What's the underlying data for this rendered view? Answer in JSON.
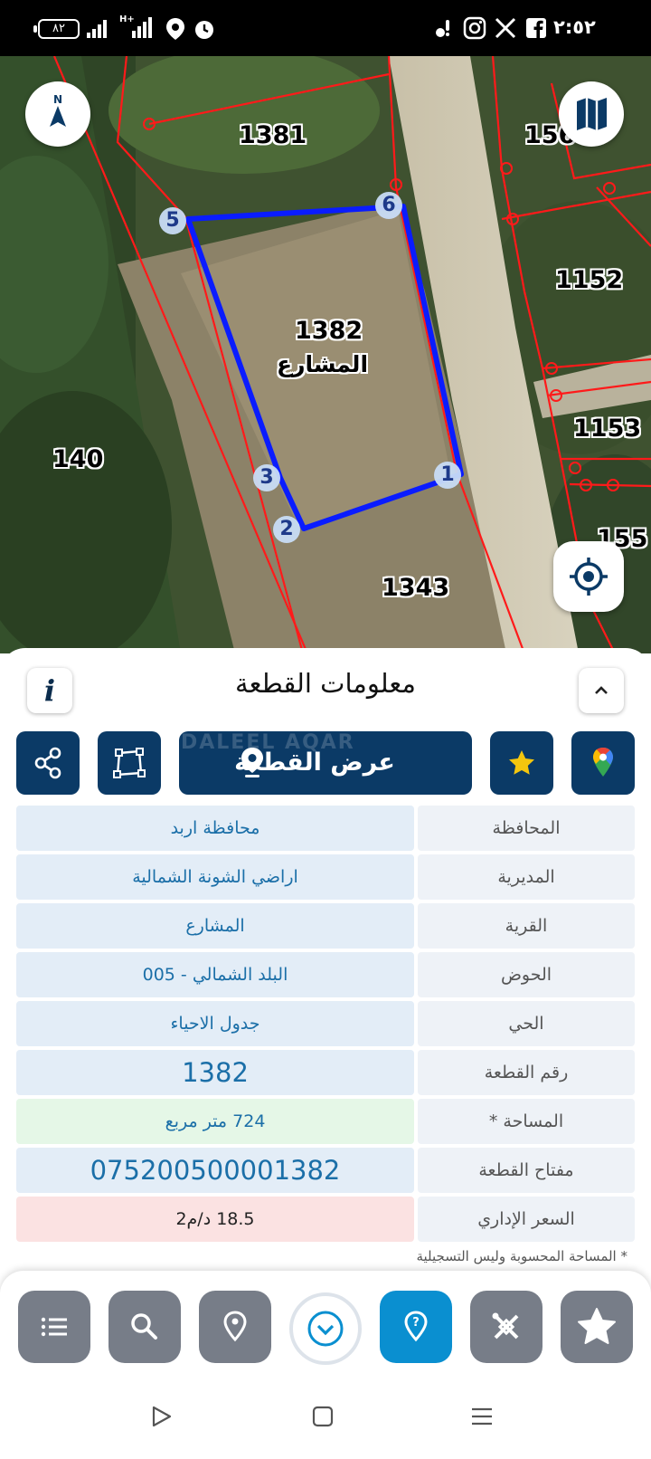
{
  "status_bar": {
    "time": "٢:٥٢",
    "battery": "٨٢",
    "network": "H+"
  },
  "map": {
    "parcel_labels": [
      {
        "id": "1381",
        "text": "1381"
      },
      {
        "id": "156",
        "text": "156"
      },
      {
        "id": "1152",
        "text": "1152"
      },
      {
        "id": "1153",
        "text": "1153"
      },
      {
        "id": "140",
        "text": "140"
      },
      {
        "id": "155",
        "text": "155"
      },
      {
        "id": "1343",
        "text": "1343"
      }
    ],
    "selected_parcel": {
      "number": "1382",
      "name": "المشارع"
    },
    "vertices": [
      "1",
      "2",
      "3",
      "5",
      "6"
    ],
    "colors": {
      "boundary": "#ff1a1a",
      "selection": "#0a1cff"
    }
  },
  "sheet": {
    "title": "معلومات القطعة",
    "info_icon": "i",
    "show_plot_label": "عرض القطعة",
    "watermark": "DALEEL AQAR",
    "rows": [
      {
        "label": "المحافظة",
        "value": "محافظة اربد"
      },
      {
        "label": "المديرية",
        "value": "اراضي الشونة الشمالية"
      },
      {
        "label": "القرية",
        "value": "المشارع"
      },
      {
        "label": "الحوض",
        "value": "البلد الشمالي - 005"
      },
      {
        "label": "الحي",
        "value": "جدول الاحياء"
      },
      {
        "label": "رقم القطعة",
        "value": "1382"
      },
      {
        "label": "المساحة *",
        "value": "724  متر مربع"
      },
      {
        "label": "مفتاح القطعة",
        "value": "075200500001382"
      },
      {
        "label": "السعر الإداري",
        "value": "18.5 د/م2"
      }
    ],
    "note": "* المساحة المحسوبة وليس التسجيلية",
    "colors": {
      "primary": "#0b3a66",
      "accent": "#0a8fd0",
      "star": "#f4c60e"
    }
  },
  "bottom_nav": {
    "items": [
      "list-icon",
      "search-icon",
      "location-pin-icon",
      "chevron-down-icon",
      "help-icon",
      "tools-icon",
      "star-icon"
    ]
  }
}
